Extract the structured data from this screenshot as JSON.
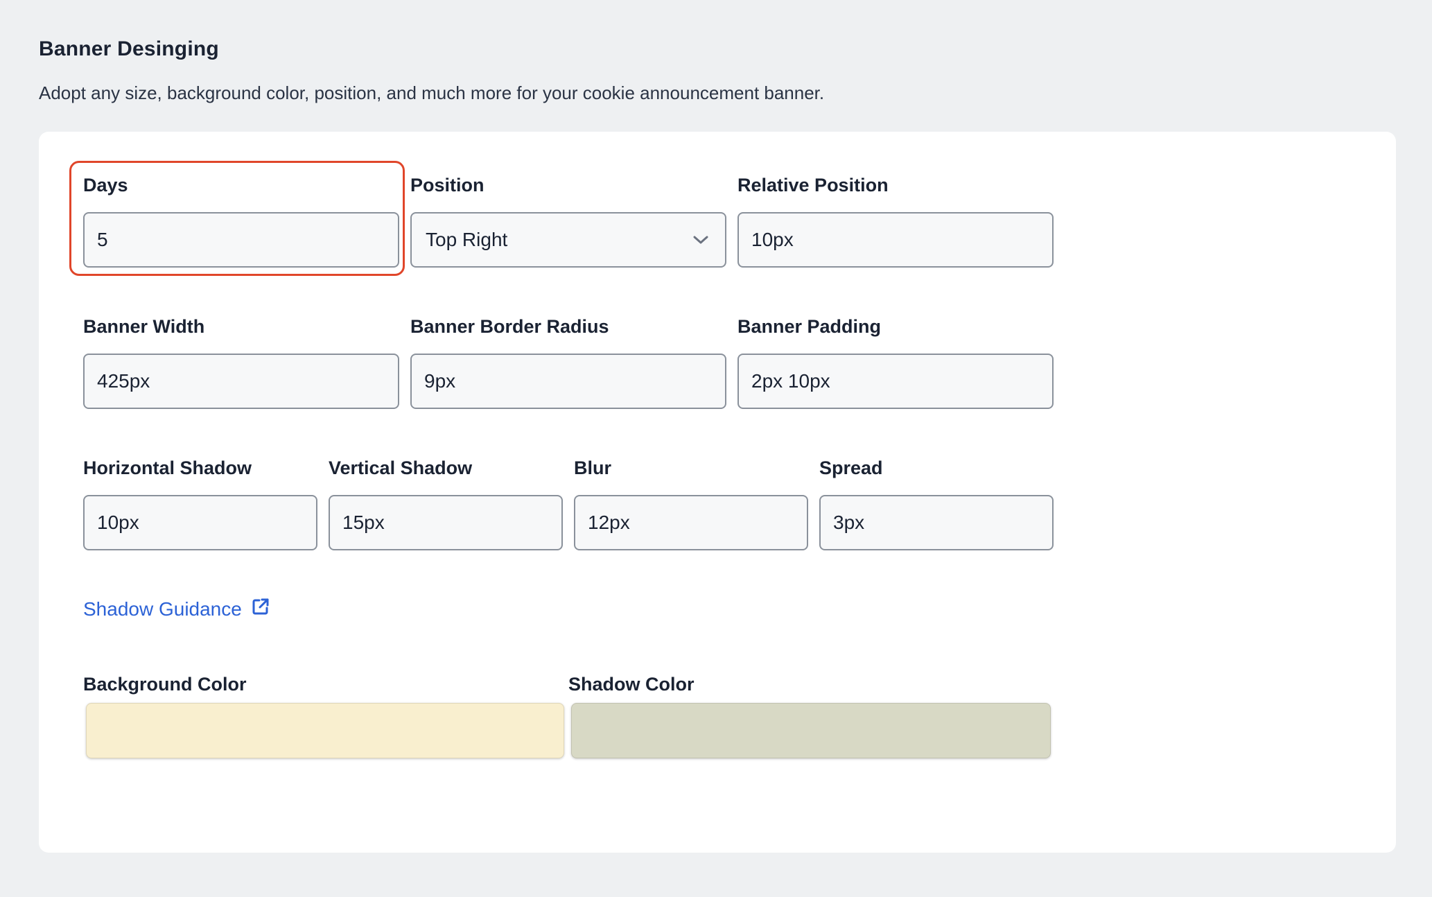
{
  "header": {
    "title": "Banner Desinging",
    "description": "Adopt any size, background color, position, and much more for your cookie announcement banner."
  },
  "fields": {
    "days": {
      "label": "Days",
      "value": "5"
    },
    "position": {
      "label": "Position",
      "value": "Top Right"
    },
    "relative_position": {
      "label": "Relative Position",
      "value": "10px"
    },
    "banner_width": {
      "label": "Banner Width",
      "value": "425px"
    },
    "banner_border_radius": {
      "label": "Banner Border Radius",
      "value": "9px"
    },
    "banner_padding": {
      "label": "Banner Padding",
      "value": "2px 10px"
    },
    "horizontal_shadow": {
      "label": "Horizontal Shadow",
      "value": "10px"
    },
    "vertical_shadow": {
      "label": "Vertical Shadow",
      "value": "15px"
    },
    "blur": {
      "label": "Blur",
      "value": "12px"
    },
    "spread": {
      "label": "Spread",
      "value": "3px"
    }
  },
  "links": {
    "shadow_guidance": "Shadow Guidance"
  },
  "colors": {
    "background_color": {
      "label": "Background Color",
      "value": "#f9efcf"
    },
    "shadow_color": {
      "label": "Shadow Color",
      "value": "#d8d9c5"
    },
    "focus_accent": "#e0462a",
    "link_color": "#2c62d6"
  },
  "icons": {
    "position_dropdown": "chevron-down-icon",
    "shadow_guidance_link": "external-link-icon"
  }
}
